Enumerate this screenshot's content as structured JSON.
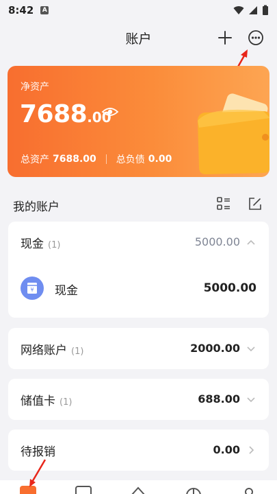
{
  "status_bar": {
    "time": "8:42",
    "badge": "A"
  },
  "nav": {
    "title": "账户"
  },
  "net_assets": {
    "label": "净资产",
    "amount_int": "7688",
    "amount_dec": ".00",
    "total_assets_label": "总资产",
    "total_assets_value": "7688.00",
    "total_liab_label": "总负债",
    "total_liab_value": "0.00"
  },
  "my_accounts": {
    "title": "我的账户"
  },
  "groups": [
    {
      "name": "现金",
      "count": "(1)",
      "total": "5000.00",
      "expanded": true,
      "items": [
        {
          "name": "现金",
          "balance": "5000.00"
        }
      ]
    },
    {
      "name": "网络账户",
      "count": "(1)",
      "total": "2000.00",
      "expanded": false
    },
    {
      "name": "储值卡",
      "count": "(1)",
      "total": "688.00",
      "expanded": false
    },
    {
      "name": "待报销",
      "count": "",
      "total": "0.00",
      "expanded": false
    }
  ],
  "colors": {
    "accent": "#f86e2f",
    "accent_end": "#fda552",
    "annotation": "#e8261a",
    "cash_icon": "#6f8df0"
  }
}
